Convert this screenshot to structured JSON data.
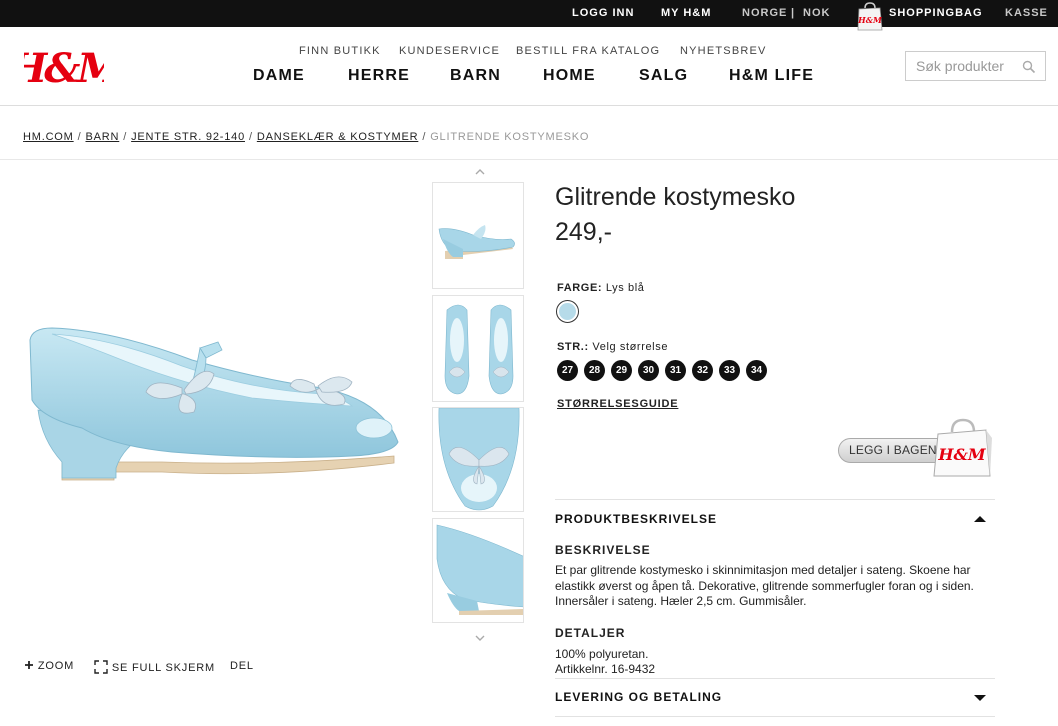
{
  "topbar": {
    "login": "LOGG INN",
    "my_hm": "MY H&M",
    "country": "NORGE",
    "divider": "|",
    "currency": "NOK",
    "shopping_bag": "SHOPPINGBAG",
    "checkout": "KASSE"
  },
  "brand": {
    "logo_text": "H&M",
    "bag_logo": "H&M",
    "color": "#e50010"
  },
  "subnav": [
    "FINN BUTIKK",
    "KUNDESERVICE",
    "BESTILL FRA KATALOG",
    "NYHETSBREV"
  ],
  "mainnav": [
    "DAME",
    "HERRE",
    "BARN",
    "HOME",
    "SALG",
    "H&M LIFE"
  ],
  "search": {
    "placeholder": "Søk produkter",
    "icon": "search-icon"
  },
  "breadcrumb": {
    "items": [
      "HM.COM",
      "BARN",
      "JENTE STR. 92-140",
      "DANSEKLÆR & KOSTYMER"
    ],
    "separator": "/",
    "current": "GLITRENDE KOSTYMESKO"
  },
  "gallery": {
    "tools": {
      "zoom": "ZOOM",
      "fullscreen": "SE FULL SKJERM",
      "share": "DEL"
    }
  },
  "product": {
    "title": "Glitrende kostymesko",
    "price": "249,-",
    "color_label": "FARGE:",
    "color_value": "Lys blå",
    "swatch_color": "#b6dbe9",
    "size_label": "STR.:",
    "size_prompt": "Velg størrelse",
    "sizes": [
      "27",
      "28",
      "29",
      "30",
      "31",
      "32",
      "33",
      "34"
    ],
    "size_guide": "STØRRELSESGUIDE",
    "add_to_bag": "LEGG I BAGEN"
  },
  "description": {
    "section_title": "PRODUKTBESKRIVELSE",
    "heading": "BESKRIVELSE",
    "text": "Et par glitrende kostymesko i skinnimitasjon med detaljer i sateng. Skoene har elastikk øverst og åpen tå. Dekorative, glitrende sommerfugler foran og i siden. Innersåler i sateng. Hæler 2,5 cm. Gummisåler.",
    "details_heading": "DETALJER",
    "details_line1": "100% polyuretan.",
    "details_line2": "Artikkelnr. 16-9432"
  },
  "delivery": {
    "section_title": "LEVERING OG BETALING"
  }
}
